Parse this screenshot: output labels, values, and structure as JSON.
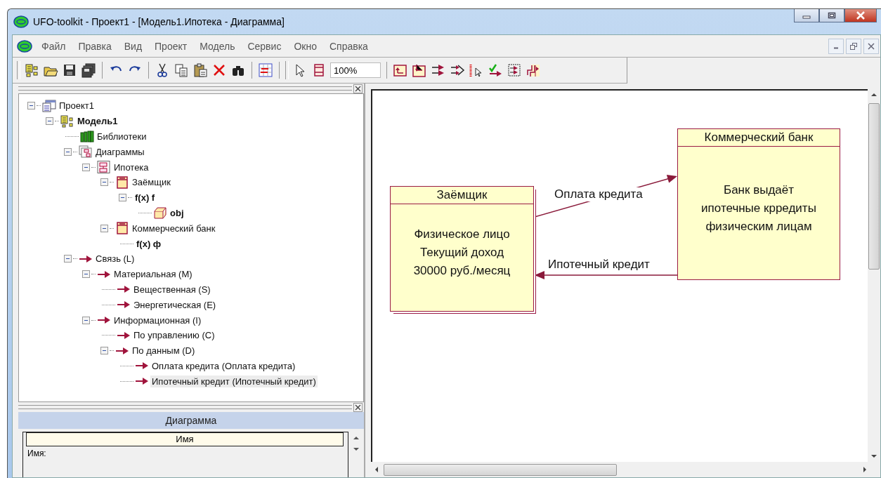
{
  "window": {
    "title": "UFO-toolkit - Проект1 - [Модель1.Ипотека - Диаграмма]"
  },
  "menu": [
    "Файл",
    "Правка",
    "Вид",
    "Проект",
    "Модель",
    "Сервис",
    "Окно",
    "Справка"
  ],
  "toolbar": {
    "zoom": "100%"
  },
  "tree": [
    {
      "label": "Проект1",
      "kind": "project",
      "bold": false,
      "selected": false,
      "expanded": true,
      "children": [
        {
          "label": "Модель1",
          "kind": "model",
          "bold": true,
          "selected": false,
          "expanded": true,
          "children": [
            {
              "label": "Библиотеки",
              "kind": "library",
              "bold": false,
              "selected": false
            },
            {
              "label": "Диаграммы",
              "kind": "diagrams",
              "bold": false,
              "selected": false,
              "expanded": true,
              "children": [
                {
                  "label": "Ипотека",
                  "kind": "diagram",
                  "bold": false,
                  "selected": false,
                  "expanded": true,
                  "children": [
                    {
                      "label": "Заёмщик",
                      "kind": "entity",
                      "bold": false,
                      "selected": false,
                      "expanded": true,
                      "children": [
                        {
                          "label": "f(x) f",
                          "kind": "function",
                          "bold": true,
                          "selected": false,
                          "expanded": true,
                          "children": [
                            {
                              "label": "obj",
                              "kind": "object",
                              "bold": true,
                              "selected": false
                            }
                          ]
                        }
                      ]
                    },
                    {
                      "label": "Коммерческий банк",
                      "kind": "entity",
                      "bold": false,
                      "selected": false,
                      "expanded": true,
                      "children": [
                        {
                          "label": "f(x) ф",
                          "kind": "function",
                          "bold": true,
                          "selected": false
                        }
                      ]
                    }
                  ]
                }
              ]
            },
            {
              "label": "Связь (L)",
              "kind": "link",
              "bold": false,
              "selected": false,
              "expanded": true,
              "children": [
                {
                  "label": "Материальная (M)",
                  "kind": "link",
                  "bold": false,
                  "selected": false,
                  "expanded": true,
                  "children": [
                    {
                      "label": "Вещественная (S)",
                      "kind": "link",
                      "bold": false,
                      "selected": false
                    },
                    {
                      "label": "Энергетическая (E)",
                      "kind": "link",
                      "bold": false,
                      "selected": false
                    }
                  ]
                },
                {
                  "label": "Информационная (I)",
                  "kind": "link",
                  "bold": false,
                  "selected": false,
                  "expanded": true,
                  "children": [
                    {
                      "label": "По управлению (C)",
                      "kind": "link",
                      "bold": false,
                      "selected": false
                    },
                    {
                      "label": "По данным (D)",
                      "kind": "link",
                      "bold": false,
                      "selected": false,
                      "expanded": true,
                      "children": [
                        {
                          "label": "Оплата кредита (Оплата кредита)",
                          "kind": "link",
                          "bold": false,
                          "selected": false
                        },
                        {
                          "label": "Ипотечный кредит (Ипотечный кредит)",
                          "kind": "link",
                          "bold": false,
                          "selected": true
                        }
                      ]
                    }
                  ]
                }
              ]
            }
          ]
        }
      ]
    }
  ],
  "properties": {
    "title": "Диаграмма",
    "column": "Имя",
    "field_label": "Имя:"
  },
  "diagram": {
    "entities": [
      {
        "name": "Заёмщик",
        "description": [
          "Физическое лицо",
          "Текущий доход",
          "30000 руб./месяц"
        ]
      },
      {
        "name": "Коммерческий банк",
        "description": [
          "Банк выдаёт",
          "ипотечные крредиты",
          "физическим лицам"
        ]
      }
    ],
    "links": [
      {
        "label": "Оплата кредита",
        "kind": "forward"
      },
      {
        "label": "Ипотечный кредит",
        "kind": "backward"
      }
    ]
  }
}
